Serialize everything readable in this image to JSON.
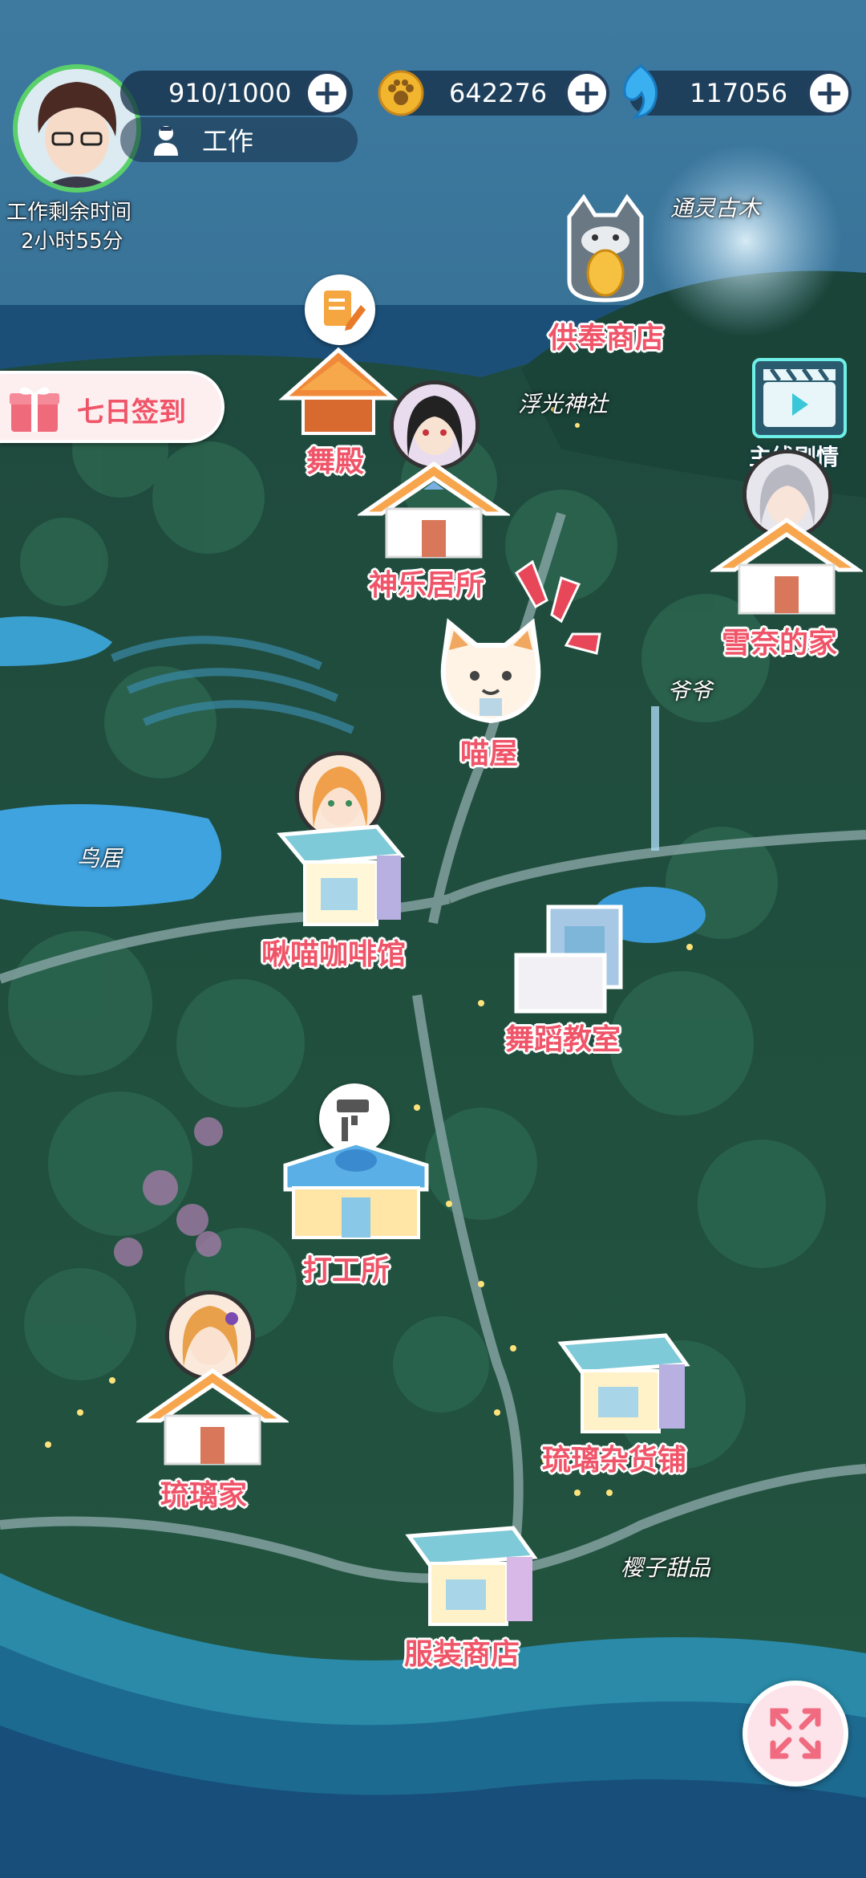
{
  "player": {
    "energy": "910/1000",
    "status": "工作",
    "work_time_label": "工作剩余时间",
    "work_time_value": "2小时55分"
  },
  "currency": {
    "paw_coins": "642276",
    "gems": "117056"
  },
  "buttons": {
    "checkin": "七日签到",
    "main_story": "主线剧情"
  },
  "buildings": {
    "offering_shop": "供奉商店",
    "dance_hall": "舞殿",
    "kagura_house": "神乐居所",
    "yukina_home": "雪奈的家",
    "cat_house": "喵屋",
    "cafe": "啾喵咖啡馆",
    "dance_studio": "舞蹈教室",
    "part_time": "打工所",
    "ruri_home": "琉璃家",
    "ruri_store": "琉璃杂货铺",
    "clothing_store": "服装商店"
  },
  "areas": {
    "ancient_tree": "通灵古木",
    "shrine": "浮光神社",
    "grandpa": "爷爷",
    "torii": "鸟居",
    "sakura_sweets": "樱子甜品"
  },
  "colors": {
    "label_red": "#f05468",
    "hud_dark": "#24405e"
  }
}
